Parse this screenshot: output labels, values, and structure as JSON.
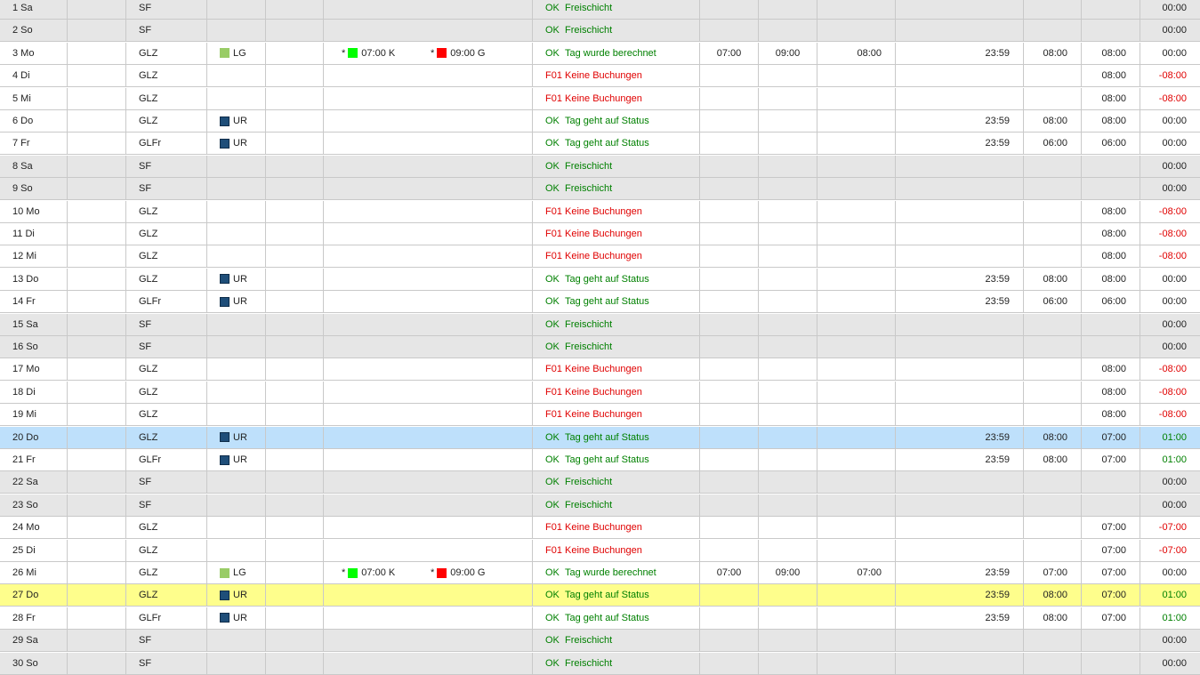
{
  "colors": {
    "absence_lg": "#99cc66",
    "absence_ur": "#1f4e79",
    "booking_kommen": "#00ff00",
    "booking_gehen": "#ff0000"
  },
  "rows": [
    {
      "day": "1 Sa",
      "model": "SF",
      "abs": "",
      "b1": null,
      "b2": null,
      "code": "OK",
      "text": "Freischicht",
      "kommen": "",
      "gehen": "",
      "ist": "",
      "kern": "",
      "sollr": "",
      "soll": "",
      "saldo": "00:00",
      "style": "weekend"
    },
    {
      "day": "2 So",
      "model": "SF",
      "abs": "",
      "b1": null,
      "b2": null,
      "code": "OK",
      "text": "Freischicht",
      "kommen": "",
      "gehen": "",
      "ist": "",
      "kern": "",
      "sollr": "",
      "soll": "",
      "saldo": "00:00",
      "style": "weekend"
    },
    {
      "day": "3 Mo",
      "model": "GLZ",
      "abs": "LG",
      "b1": {
        "star": "*",
        "time": "07:00 K"
      },
      "b2": {
        "star": "*",
        "time": "09:00 G"
      },
      "code": "OK",
      "text": "Tag wurde berechnet",
      "kommen": "07:00",
      "gehen": "09:00",
      "ist": "08:00",
      "kern": "23:59",
      "sollr": "08:00",
      "soll": "08:00",
      "saldo": "00:00",
      "style": ""
    },
    {
      "day": "4 Di",
      "model": "GLZ",
      "abs": "",
      "b1": null,
      "b2": null,
      "code": "F01",
      "text": "Keine Buchungen",
      "kommen": "",
      "gehen": "",
      "ist": "",
      "kern": "",
      "sollr": "",
      "soll": "08:00",
      "saldo": "-08:00",
      "style": ""
    },
    {
      "day": "5 Mi",
      "model": "GLZ",
      "abs": "",
      "b1": null,
      "b2": null,
      "code": "F01",
      "text": "Keine Buchungen",
      "kommen": "",
      "gehen": "",
      "ist": "",
      "kern": "",
      "sollr": "",
      "soll": "08:00",
      "saldo": "-08:00",
      "style": ""
    },
    {
      "day": "6 Do",
      "model": "GLZ",
      "abs": "UR",
      "b1": null,
      "b2": null,
      "code": "OK",
      "text": "Tag geht auf Status",
      "kommen": "",
      "gehen": "",
      "ist": "",
      "kern": "23:59",
      "sollr": "08:00",
      "soll": "08:00",
      "saldo": "00:00",
      "style": ""
    },
    {
      "day": "7 Fr",
      "model": "GLFr",
      "abs": "UR",
      "b1": null,
      "b2": null,
      "code": "OK",
      "text": "Tag geht auf Status",
      "kommen": "",
      "gehen": "",
      "ist": "",
      "kern": "23:59",
      "sollr": "06:00",
      "soll": "06:00",
      "saldo": "00:00",
      "style": ""
    },
    {
      "day": "8 Sa",
      "model": "SF",
      "abs": "",
      "b1": null,
      "b2": null,
      "code": "OK",
      "text": "Freischicht",
      "kommen": "",
      "gehen": "",
      "ist": "",
      "kern": "",
      "sollr": "",
      "soll": "",
      "saldo": "00:00",
      "style": "weekend"
    },
    {
      "day": "9 So",
      "model": "SF",
      "abs": "",
      "b1": null,
      "b2": null,
      "code": "OK",
      "text": "Freischicht",
      "kommen": "",
      "gehen": "",
      "ist": "",
      "kern": "",
      "sollr": "",
      "soll": "",
      "saldo": "00:00",
      "style": "weekend"
    },
    {
      "day": "10 Mo",
      "model": "GLZ",
      "abs": "",
      "b1": null,
      "b2": null,
      "code": "F01",
      "text": "Keine Buchungen",
      "kommen": "",
      "gehen": "",
      "ist": "",
      "kern": "",
      "sollr": "",
      "soll": "08:00",
      "saldo": "-08:00",
      "style": ""
    },
    {
      "day": "11 Di",
      "model": "GLZ",
      "abs": "",
      "b1": null,
      "b2": null,
      "code": "F01",
      "text": "Keine Buchungen",
      "kommen": "",
      "gehen": "",
      "ist": "",
      "kern": "",
      "sollr": "",
      "soll": "08:00",
      "saldo": "-08:00",
      "style": ""
    },
    {
      "day": "12 Mi",
      "model": "GLZ",
      "abs": "",
      "b1": null,
      "b2": null,
      "code": "F01",
      "text": "Keine Buchungen",
      "kommen": "",
      "gehen": "",
      "ist": "",
      "kern": "",
      "sollr": "",
      "soll": "08:00",
      "saldo": "-08:00",
      "style": ""
    },
    {
      "day": "13 Do",
      "model": "GLZ",
      "abs": "UR",
      "b1": null,
      "b2": null,
      "code": "OK",
      "text": "Tag geht auf Status",
      "kommen": "",
      "gehen": "",
      "ist": "",
      "kern": "23:59",
      "sollr": "08:00",
      "soll": "08:00",
      "saldo": "00:00",
      "style": ""
    },
    {
      "day": "14 Fr",
      "model": "GLFr",
      "abs": "UR",
      "b1": null,
      "b2": null,
      "code": "OK",
      "text": "Tag geht auf Status",
      "kommen": "",
      "gehen": "",
      "ist": "",
      "kern": "23:59",
      "sollr": "06:00",
      "soll": "06:00",
      "saldo": "00:00",
      "style": ""
    },
    {
      "day": "15 Sa",
      "model": "SF",
      "abs": "",
      "b1": null,
      "b2": null,
      "code": "OK",
      "text": "Freischicht",
      "kommen": "",
      "gehen": "",
      "ist": "",
      "kern": "",
      "sollr": "",
      "soll": "",
      "saldo": "00:00",
      "style": "weekend"
    },
    {
      "day": "16 So",
      "model": "SF",
      "abs": "",
      "b1": null,
      "b2": null,
      "code": "OK",
      "text": "Freischicht",
      "kommen": "",
      "gehen": "",
      "ist": "",
      "kern": "",
      "sollr": "",
      "soll": "",
      "saldo": "00:00",
      "style": "weekend"
    },
    {
      "day": "17 Mo",
      "model": "GLZ",
      "abs": "",
      "b1": null,
      "b2": null,
      "code": "F01",
      "text": "Keine Buchungen",
      "kommen": "",
      "gehen": "",
      "ist": "",
      "kern": "",
      "sollr": "",
      "soll": "08:00",
      "saldo": "-08:00",
      "style": ""
    },
    {
      "day": "18 Di",
      "model": "GLZ",
      "abs": "",
      "b1": null,
      "b2": null,
      "code": "F01",
      "text": "Keine Buchungen",
      "kommen": "",
      "gehen": "",
      "ist": "",
      "kern": "",
      "sollr": "",
      "soll": "08:00",
      "saldo": "-08:00",
      "style": ""
    },
    {
      "day": "19 Mi",
      "model": "GLZ",
      "abs": "",
      "b1": null,
      "b2": null,
      "code": "F01",
      "text": "Keine Buchungen",
      "kommen": "",
      "gehen": "",
      "ist": "",
      "kern": "",
      "sollr": "",
      "soll": "08:00",
      "saldo": "-08:00",
      "style": ""
    },
    {
      "day": "20 Do",
      "model": "GLZ",
      "abs": "UR",
      "b1": null,
      "b2": null,
      "code": "OK",
      "text": "Tag geht auf Status",
      "kommen": "",
      "gehen": "",
      "ist": "",
      "kern": "23:59",
      "sollr": "08:00",
      "soll": "07:00",
      "saldo": "01:00",
      "style": "selected"
    },
    {
      "day": "21 Fr",
      "model": "GLFr",
      "abs": "UR",
      "b1": null,
      "b2": null,
      "code": "OK",
      "text": "Tag geht auf Status",
      "kommen": "",
      "gehen": "",
      "ist": "",
      "kern": "23:59",
      "sollr": "08:00",
      "soll": "07:00",
      "saldo": "01:00",
      "style": ""
    },
    {
      "day": "22 Sa",
      "model": "SF",
      "abs": "",
      "b1": null,
      "b2": null,
      "code": "OK",
      "text": "Freischicht",
      "kommen": "",
      "gehen": "",
      "ist": "",
      "kern": "",
      "sollr": "",
      "soll": "",
      "saldo": "00:00",
      "style": "weekend"
    },
    {
      "day": "23 So",
      "model": "SF",
      "abs": "",
      "b1": null,
      "b2": null,
      "code": "OK",
      "text": "Freischicht",
      "kommen": "",
      "gehen": "",
      "ist": "",
      "kern": "",
      "sollr": "",
      "soll": "",
      "saldo": "00:00",
      "style": "weekend"
    },
    {
      "day": "24 Mo",
      "model": "GLZ",
      "abs": "",
      "b1": null,
      "b2": null,
      "code": "F01",
      "text": "Keine Buchungen",
      "kommen": "",
      "gehen": "",
      "ist": "",
      "kern": "",
      "sollr": "",
      "soll": "07:00",
      "saldo": "-07:00",
      "style": ""
    },
    {
      "day": "25 Di",
      "model": "GLZ",
      "abs": "",
      "b1": null,
      "b2": null,
      "code": "F01",
      "text": "Keine Buchungen",
      "kommen": "",
      "gehen": "",
      "ist": "",
      "kern": "",
      "sollr": "",
      "soll": "07:00",
      "saldo": "-07:00",
      "style": ""
    },
    {
      "day": "26 Mi",
      "model": "GLZ",
      "abs": "LG",
      "b1": {
        "star": "*",
        "time": "07:00 K"
      },
      "b2": {
        "star": "*",
        "time": "09:00 G"
      },
      "code": "OK",
      "text": "Tag wurde berechnet",
      "kommen": "07:00",
      "gehen": "09:00",
      "ist": "07:00",
      "kern": "23:59",
      "sollr": "07:00",
      "soll": "07:00",
      "saldo": "00:00",
      "style": ""
    },
    {
      "day": "27 Do",
      "model": "GLZ",
      "abs": "UR",
      "b1": null,
      "b2": null,
      "code": "OK",
      "text": "Tag geht auf Status",
      "kommen": "",
      "gehen": "",
      "ist": "",
      "kern": "23:59",
      "sollr": "08:00",
      "soll": "07:00",
      "saldo": "01:00",
      "style": "highlight"
    },
    {
      "day": "28 Fr",
      "model": "GLFr",
      "abs": "UR",
      "b1": null,
      "b2": null,
      "code": "OK",
      "text": "Tag geht auf Status",
      "kommen": "",
      "gehen": "",
      "ist": "",
      "kern": "23:59",
      "sollr": "08:00",
      "soll": "07:00",
      "saldo": "01:00",
      "style": ""
    },
    {
      "day": "29 Sa",
      "model": "SF",
      "abs": "",
      "b1": null,
      "b2": null,
      "code": "OK",
      "text": "Freischicht",
      "kommen": "",
      "gehen": "",
      "ist": "",
      "kern": "",
      "sollr": "",
      "soll": "",
      "saldo": "00:00",
      "style": "weekend"
    },
    {
      "day": "30 So",
      "model": "SF",
      "abs": "",
      "b1": null,
      "b2": null,
      "code": "OK",
      "text": "Freischicht",
      "kommen": "",
      "gehen": "",
      "ist": "",
      "kern": "",
      "sollr": "",
      "soll": "",
      "saldo": "00:00",
      "style": "weekend"
    }
  ]
}
